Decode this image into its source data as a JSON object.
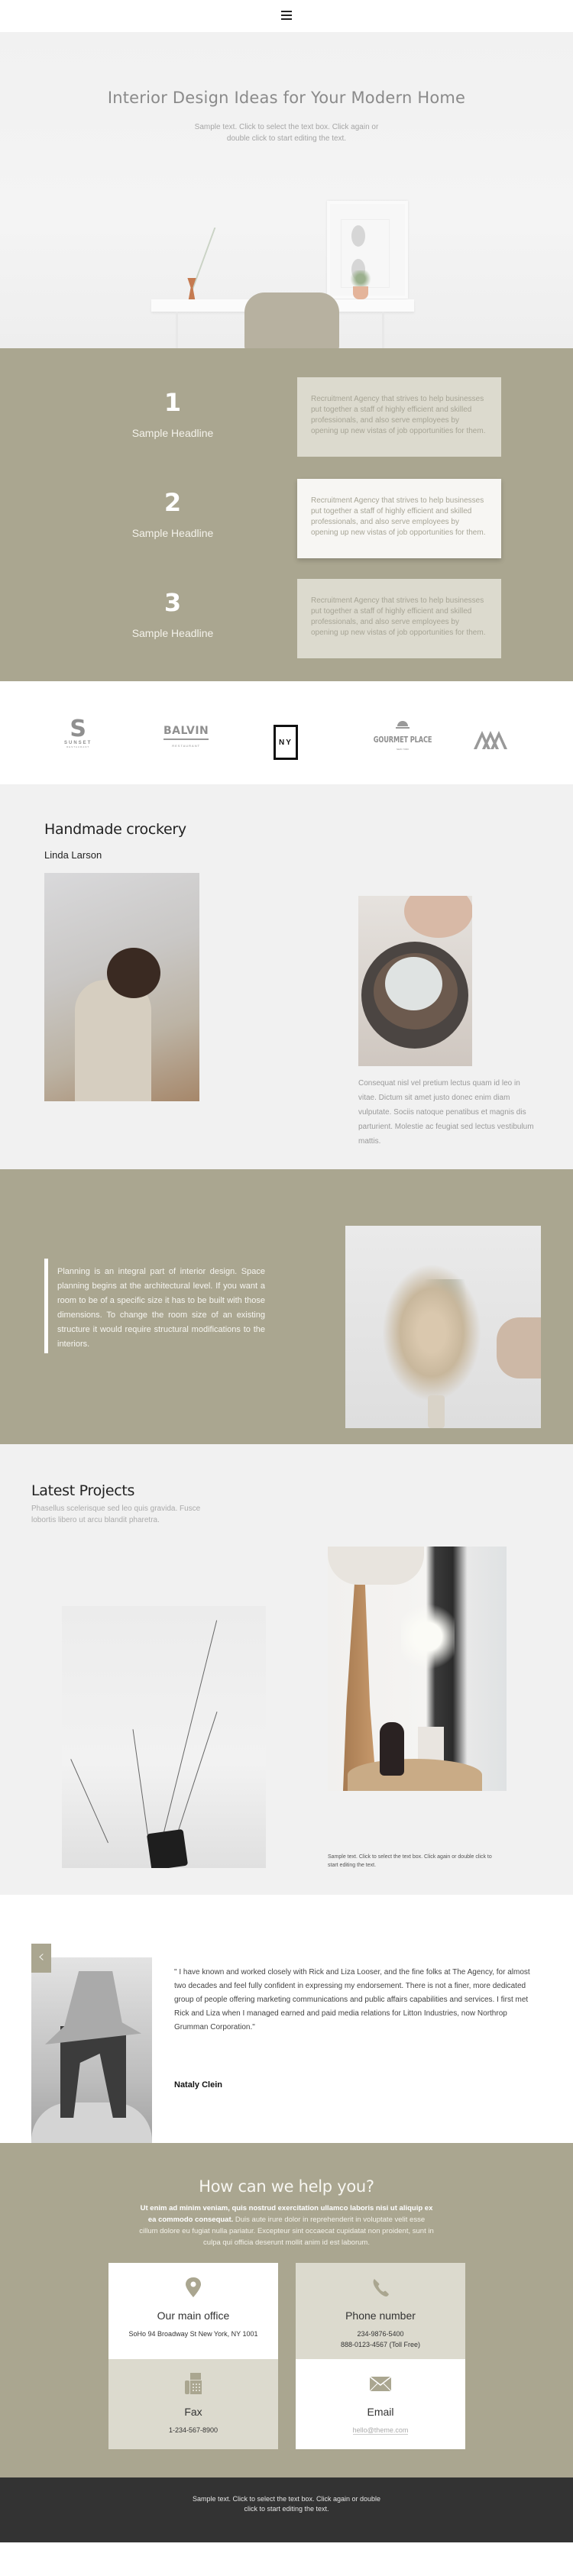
{
  "header": {
    "menu_icon": "hamburger-menu-icon"
  },
  "hero": {
    "title": "Interior Design Ideas for Your Modern Home",
    "text": "Sample text. Click to select the text box. Click again or double click to start editing the text."
  },
  "steps": {
    "items": [
      {
        "number": "1",
        "headline": "Sample Headline",
        "text": "Recruitment Agency that strives to help businesses put together a staff of highly efficient and skilled professionals, and also serve employees by opening up new vistas of job opportunities for them.",
        "active": false
      },
      {
        "number": "2",
        "headline": "Sample Headline",
        "text": "Recruitment Agency that strives to help businesses put together a staff of highly efficient and skilled professionals, and also serve employees by opening up new vistas of job opportunities for them.",
        "active": true
      },
      {
        "number": "3",
        "headline": "Sample Headline",
        "text": "Recruitment Agency that strives to help businesses put together a staff of highly efficient and skilled professionals, and also serve employees by opening up new vistas of job opportunities for them.",
        "active": false
      }
    ]
  },
  "logos": {
    "sunset": {
      "mark": "S",
      "name": "SUNSET",
      "sub": "RESTAURANT"
    },
    "balvin": {
      "name": "BALVIN",
      "sub": "RESTAURANT"
    },
    "ny": {
      "name": "NY"
    },
    "gourmet": {
      "name": "GOURMET PLACE",
      "sub": "NEW YORK"
    },
    "mountain": {
      "icon": "mountain-logo-icon"
    }
  },
  "crockery": {
    "title": "Handmade crockery",
    "author": "Linda Larson",
    "text": "Consequat nisl vel pretium lectus quam id leo in vitae. Dictum sit amet justo donec enim diam vulputate. Sociis natoque penatibus et magnis dis parturient. Molestie ac feugiat sed lectus vestibulum mattis."
  },
  "planning": {
    "text": "Planning is an integral part of interior design. Space planning begins at the architectural level. If you want a room to be of a specific size it has to be built with those dimensions. To change the room size of an existing structure it would require structural modifications to the interiors."
  },
  "projects": {
    "title": "Latest Projects",
    "subtitle": "Phasellus scelerisque sed leo quis gravida. Fusce lobortis libero ut arcu blandit pharetra.",
    "caption": "Sample text. Click to select the text box. Click again or double click to start editing the text."
  },
  "testimonial": {
    "prev_icon": "chevron-left-icon",
    "next_icon": "chevron-right-icon",
    "prev_label": "‹",
    "next_label": "›",
    "quote": "\" I have known and worked closely with Rick and Liza Looser, and the fine folks at The Agency, for almost two decades and feel fully confident in expressing my endorsement. There is not a finer, more dedicated group of people offering marketing communications and public affairs capabilities and services. I first met Rick and Liza when I managed earned and paid media relations for Litton Industries, now Northrop Grumman Corporation.\"",
    "author": "Nataly Clein",
    "slides": 2,
    "current_slide": 1
  },
  "help": {
    "title": "How can we help you?",
    "text_bold": "Ut enim ad minim veniam, quis nostrud exercitation ullamco laboris nisi ut aliquip ex ea commodo consequat.",
    "text_rest": " Duis aute irure dolor in reprehenderit in voluptate velit esse cillum dolore eu fugiat nulla pariatur. Excepteur sint occaecat cupidatat non proident, sunt in culpa qui officia deserunt mollit anim id est laborum.",
    "cards": [
      {
        "icon": "map-pin-icon",
        "title": "Our main office",
        "lines": [
          "SoHo 94 Broadway St New York, NY 1001"
        ]
      },
      {
        "icon": "phone-icon",
        "title": "Phone number",
        "lines": [
          "234-9876-5400",
          "888-0123-4567 (Toll Free)"
        ]
      },
      {
        "icon": "fax-icon",
        "title": "Fax",
        "lines": [
          "1-234-567-8900"
        ]
      },
      {
        "icon": "envelope-icon",
        "title": "Email",
        "link": "hello@theme.com"
      }
    ]
  },
  "footer": {
    "text": "Sample text. Click to select the text box. Click again or double click to start editing the text."
  },
  "colors": {
    "accent": "#aaa690",
    "card_beige": "#dcdace",
    "footer": "#333333",
    "light_bg": "#f1f1f1"
  }
}
